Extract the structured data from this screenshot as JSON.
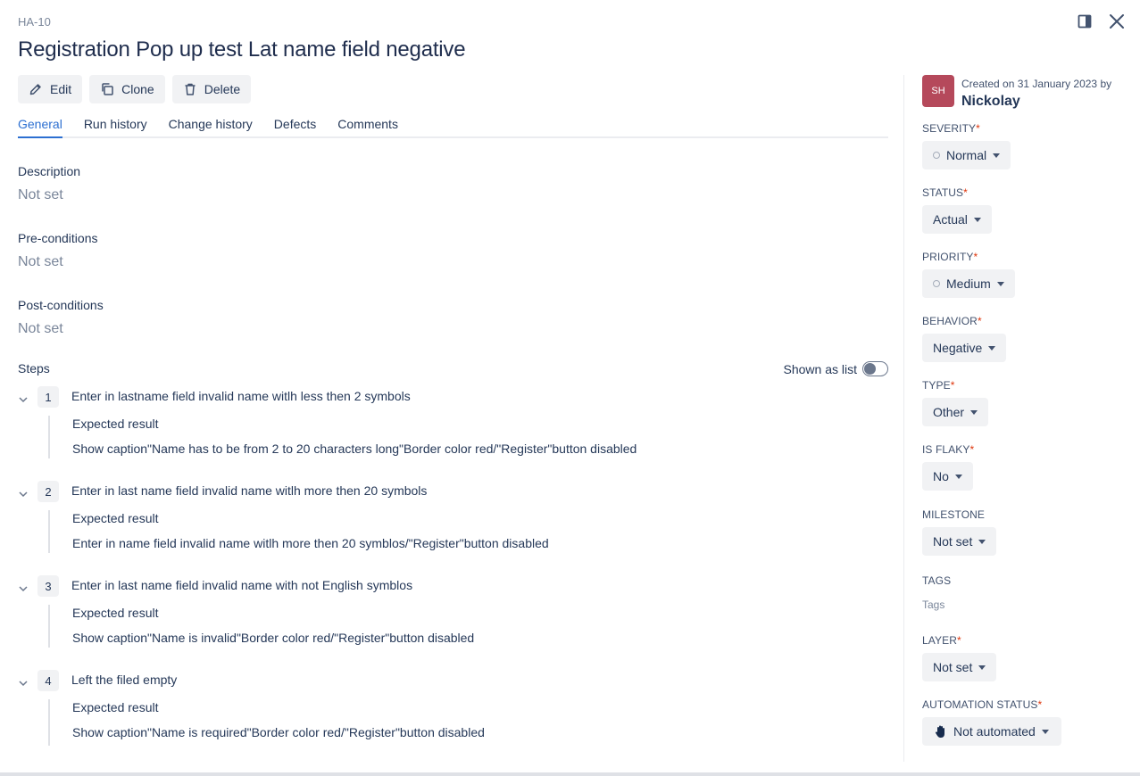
{
  "header": {
    "issue_key": "HA-10",
    "title": "Registration Pop up test Lat name field negative"
  },
  "toolbar": {
    "edit_label": "Edit",
    "clone_label": "Clone",
    "delete_label": "Delete"
  },
  "tabs": [
    {
      "label": "General",
      "active": true
    },
    {
      "label": "Run history"
    },
    {
      "label": "Change history"
    },
    {
      "label": "Defects"
    },
    {
      "label": "Comments"
    }
  ],
  "general": {
    "description_label": "Description",
    "description_value": "Not set",
    "preconditions_label": "Pre-conditions",
    "preconditions_value": "Not set",
    "postconditions_label": "Post-conditions",
    "postconditions_value": "Not set"
  },
  "steps": {
    "label": "Steps",
    "toggle_label": "Shown as list",
    "toggle_on": false,
    "expected_label": "Expected result",
    "items": [
      {
        "num": "1",
        "text": "Enter in lastname field invalid name witlh less then 2 symbols",
        "expected": "Show caption\"Name has to be from 2 to 20 characters long\"Border color red/\"Register\"button disabled"
      },
      {
        "num": "2",
        "text": "Enter in last name field invalid name witlh more then 20 symbols",
        "expected": "Enter in name field invalid name witlh more then 20 symblos/\"Register\"button disabled"
      },
      {
        "num": "3",
        "text": "Enter in last name field invalid name with not English symblos",
        "expected": "Show caption\"Name is invalid\"Border color red/\"Register\"button disabled"
      },
      {
        "num": "4",
        "text": "Left the filed empty",
        "expected": "Show caption\"Name is required\"Border color red/\"Register\"button disabled"
      }
    ]
  },
  "sidebar": {
    "avatar_initials": "SH",
    "created_text": "Created on 31 January 2023 by",
    "creator": "Nickolay",
    "fields": {
      "severity": {
        "label": "SEVERITY",
        "value": "Normal"
      },
      "status": {
        "label": "STATUS",
        "value": "Actual"
      },
      "priority": {
        "label": "PRIORITY",
        "value": "Medium"
      },
      "behavior": {
        "label": "BEHAVIOR",
        "value": "Negative"
      },
      "type": {
        "label": "TYPE",
        "value": "Other"
      },
      "is_flaky": {
        "label": "IS FLAKY",
        "value": "No"
      },
      "milestone": {
        "label": "MILESTONE",
        "value": "Not set"
      },
      "tags": {
        "label": "TAGS",
        "placeholder": "Tags"
      },
      "layer": {
        "label": "LAYER",
        "value": "Not set"
      },
      "automation_status": {
        "label": "AUTOMATION STATUS",
        "value": "Not automated"
      }
    },
    "required_mark": "*"
  },
  "colors": {
    "accent": "#2c6fd1",
    "required": "#de350b",
    "avatar": "#b5495b"
  }
}
